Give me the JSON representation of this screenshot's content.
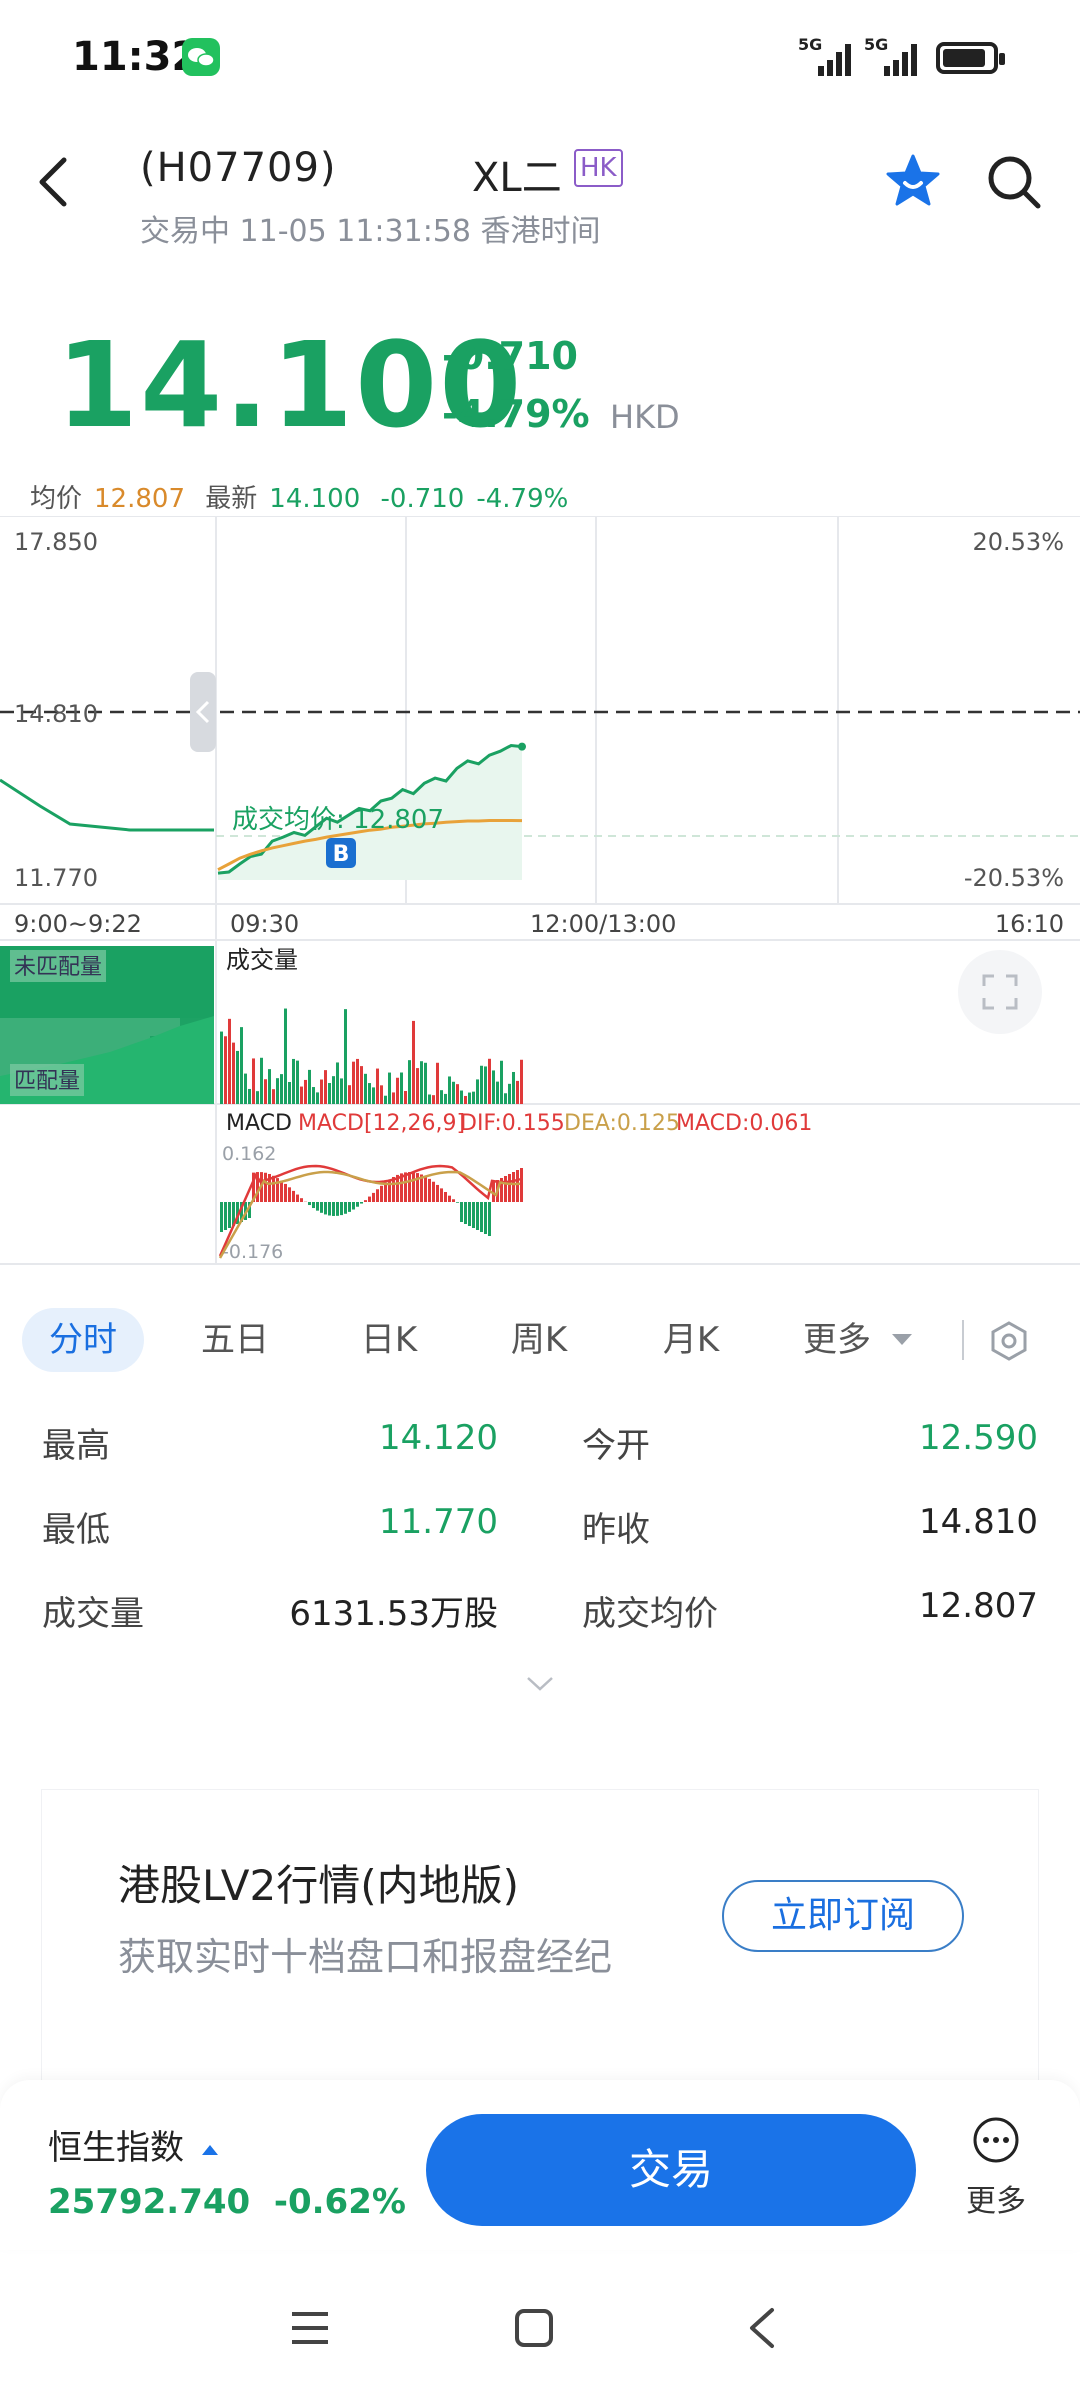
{
  "status_bar": {
    "time": "11:32",
    "signal1": "5G",
    "signal2": "5G"
  },
  "header": {
    "code": "(H07709)",
    "name": "XL二",
    "market_badge": "HK",
    "trading_status": "交易中 11-05 11:31:58 香港时间"
  },
  "quote": {
    "price": "14.100",
    "change": "-0.710",
    "change_pct": "-4.79%",
    "currency": "HKD"
  },
  "summary_line": {
    "avg_label": "均价",
    "avg_value": "12.807",
    "latest_label": "最新",
    "latest_value": "14.100",
    "latest_change": "-0.710",
    "latest_pct": "-4.79%"
  },
  "chart_data": {
    "type": "line",
    "price_axis": {
      "top": "17.850",
      "mid": "14.810",
      "bottom": "11.770"
    },
    "pct_axis": {
      "top": "20.53%",
      "bottom": "-20.53%"
    },
    "time_labels": [
      "9:00~9:22",
      "09:30",
      "12:00/13:00",
      "16:10"
    ],
    "avg_label": "成交均价: 12.807",
    "buy_marker": "B",
    "volume_label": "成交量",
    "unmatched_label": "未匹配量",
    "matched_label": "匹配量",
    "macd": {
      "label": "MACD",
      "params": "MACD[12,26,9]",
      "dif": "DIF:0.155",
      "dea": "DEA:0.125",
      "macd": "MACD:0.061",
      "top": "0.162",
      "bottom": "-0.176"
    },
    "series": [
      {
        "name": "price",
        "values": [
          11.89,
          11.91,
          12.05,
          12.18,
          12.22,
          12.45,
          12.52,
          12.6,
          12.55,
          12.7,
          12.85,
          12.78,
          12.9,
          13.02,
          12.98,
          13.15,
          13.2,
          13.35,
          13.28,
          13.46,
          13.55,
          13.5,
          13.72,
          13.85,
          13.8,
          13.95,
          14.02,
          14.12,
          14.1
        ]
      },
      {
        "name": "avg",
        "values": [
          11.95,
          12.05,
          12.15,
          12.22,
          12.28,
          12.33,
          12.37,
          12.41,
          12.45,
          12.48,
          12.52,
          12.55,
          12.58,
          12.61,
          12.64,
          12.66,
          12.69,
          12.71,
          12.73,
          12.75,
          12.76,
          12.78,
          12.79,
          12.8,
          12.8,
          12.81,
          12.81,
          12.81,
          12.807
        ]
      }
    ]
  },
  "tabs": [
    "分时",
    "五日",
    "日K",
    "周K",
    "月K",
    "更多"
  ],
  "stats": {
    "high_label": "最高",
    "high_value": "14.120",
    "open_label": "今开",
    "open_value": "12.590",
    "low_label": "最低",
    "low_value": "11.770",
    "prev_label": "昨收",
    "prev_value": "14.810",
    "vol_label": "成交量",
    "vol_value": "6131.53万股",
    "avgp_label": "成交均价",
    "avgp_value": "12.807"
  },
  "promo": {
    "title": "港股LV2行情(内地版)",
    "subtitle": "获取实时十档盘口和报盘经纪",
    "button": "立即订阅"
  },
  "bottom": {
    "index_name": "恒生指数",
    "index_value": "25792.740",
    "index_change": "-0.62%",
    "trade": "交易",
    "more": "更多"
  },
  "colors": {
    "up_green": "#1aa162",
    "avg_orange": "#e8a23a",
    "accent_blue": "#1a73e8"
  }
}
